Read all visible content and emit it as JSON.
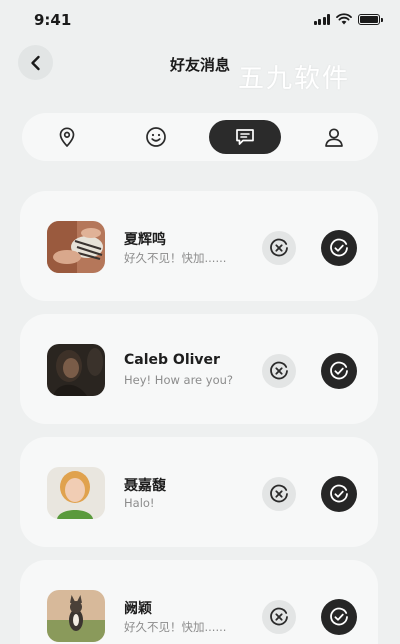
{
  "status_bar": {
    "time": "9:41"
  },
  "header": {
    "title": "好友消息",
    "watermark": "五九软件"
  },
  "tabs": [
    {
      "icon": "location-pin-icon",
      "active": false
    },
    {
      "icon": "smiley-icon",
      "active": false
    },
    {
      "icon": "message-icon",
      "active": true
    },
    {
      "icon": "user-icon",
      "active": false
    }
  ],
  "messages": [
    {
      "name": "夏辉鸣",
      "text": "好久不见！快加......"
    },
    {
      "name": "Caleb Oliver",
      "text": "Hey! How are you?"
    },
    {
      "name": "聂嘉馥",
      "text": "Halo!"
    },
    {
      "name": "阙颖",
      "text": "好久不见！快加......"
    }
  ],
  "colors": {
    "accent": "#262626",
    "background": "#eef0f0",
    "card": "#f7f8f8"
  }
}
